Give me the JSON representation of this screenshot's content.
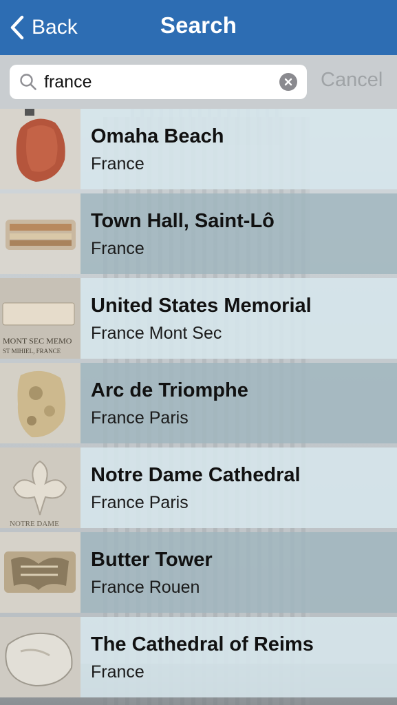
{
  "nav": {
    "back_label": "Back",
    "title": "Search"
  },
  "search": {
    "value": "france",
    "cancel_label": "Cancel"
  },
  "colors": {
    "navbar": "#2d6db3",
    "row_light": "#d6e6ec",
    "row_dark": "#a0b6be"
  },
  "results": [
    {
      "title": "Omaha Beach",
      "subtitle": "France",
      "thumb": "red-stone"
    },
    {
      "title": "Town Hall, Saint-Lô",
      "subtitle": "France",
      "thumb": "striped-stone"
    },
    {
      "title": "United States Memorial",
      "subtitle": "France Mont Sec",
      "thumb": "engraved-plaque",
      "thumb_text": [
        "MONT SEC MEMO",
        "ST MIHIEL, FRANCE"
      ]
    },
    {
      "title": "Arc de Triomphe",
      "subtitle": "France Paris",
      "thumb": "rough-stone"
    },
    {
      "title": "Notre Dame Cathedral",
      "subtitle": "France Paris",
      "thumb": "fleur-carving",
      "thumb_text": [
        "NOTRE DAME"
      ]
    },
    {
      "title": "Butter Tower",
      "subtitle": "France Rouen",
      "thumb": "carved-stone"
    },
    {
      "title": "The Cathedral of Reims",
      "subtitle": "France",
      "thumb": "grey-stone"
    }
  ]
}
